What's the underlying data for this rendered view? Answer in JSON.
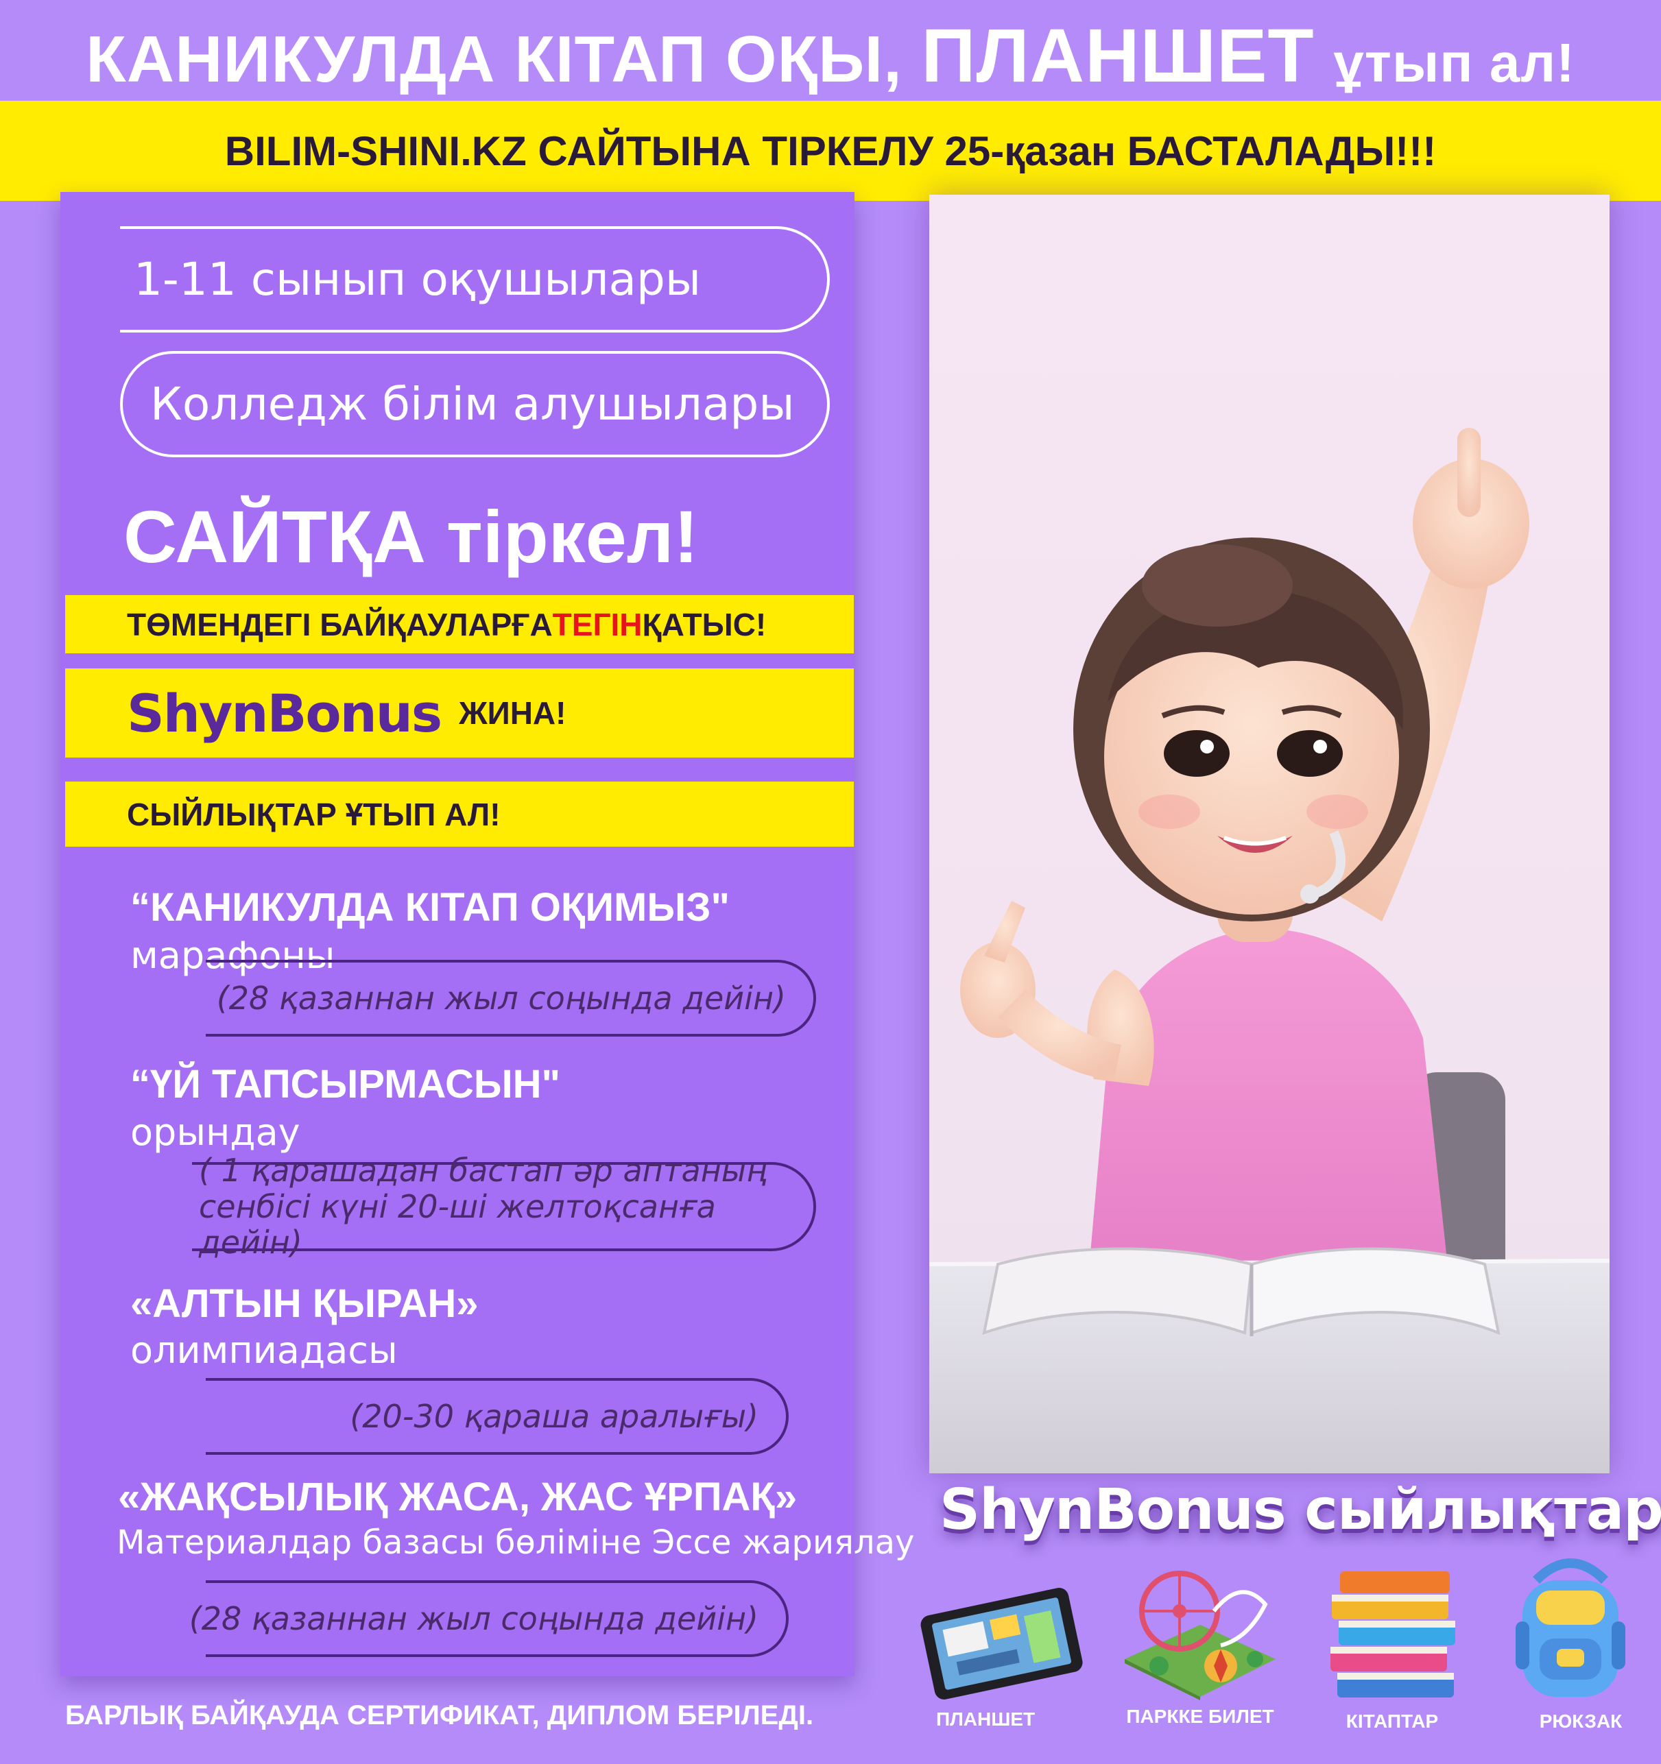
{
  "header": {
    "part1": "КАНИКУЛДА КІТАП ОҚЫ,",
    "part2": "ПЛАНШЕТ",
    "part3": "ұтып ал!"
  },
  "announcement": "BILIM-SHINI.KZ САЙТЫНА ТІРКЕЛУ 25-қазан БАСТАЛАДЫ!!!",
  "audience": {
    "grades": "1-11 сынып оқушылары",
    "college": "Колледж білім алушылары"
  },
  "register_cta": "САЙТҚА тіркел!",
  "participate": {
    "before": "ТӨМЕНДЕГІ БАЙҚАУЛАРҒА ",
    "free": "ТЕГІН",
    "after": " ҚАТЫС!"
  },
  "bonus": {
    "brand": "ShynBonus",
    "action": "ЖИНА!"
  },
  "prizes_cta": "СЫЙЛЫҚТАР ҰТЫП АЛ!",
  "contests": [
    {
      "title": "“КАНИКУЛДА КІТАП ОҚИМЫЗ\"",
      "subtitle": "марафоны",
      "dates": "(28 қазаннан жыл соңында дейін)"
    },
    {
      "title": "“ҮЙ ТАПСЫРМАСЫН\"",
      "subtitle": "орындау",
      "dates_line1": "( 1 қарашадан бастап әр аптаның",
      "dates_line2": "сенбісі күні 20-ші желтоқсанға дейін)"
    },
    {
      "title": "«АЛТЫН ҚЫРАН»",
      "subtitle": "олимпиадасы",
      "dates": "(20-30  қараша аралығы)"
    },
    {
      "title": "«ЖАҚСЫЛЫҚ ЖАСА, ЖАС ҰРПАҚ»",
      "subtitle": "Материалдар базасы бөліміне Эссе жариялау",
      "dates": "(28 қазаннан жыл соңында дейін)"
    }
  ],
  "footer_note": "БАРЛЫҚ БАЙҚАУДА СЕРТИФИКАТ, ДИПЛОМ БЕРІЛЕДІ.",
  "shynbonus_prizes": {
    "heading": "ShynBonus сыйлықтары",
    "items": [
      {
        "label": "ПЛАНШЕТ",
        "icon": "tablet-icon"
      },
      {
        "label": "ПАРККЕ БИЛЕТ",
        "icon": "amusement-park-icon"
      },
      {
        "label": "КІТАПТАР",
        "icon": "books-icon"
      },
      {
        "label": "РЮКЗАК",
        "icon": "backpack-icon"
      }
    ]
  },
  "colors": {
    "background": "#b48bf8",
    "panel": "#a46ff5",
    "yellow": "#ffec00",
    "accent_red": "#e8141c",
    "dark_purple": "#4a2480"
  }
}
